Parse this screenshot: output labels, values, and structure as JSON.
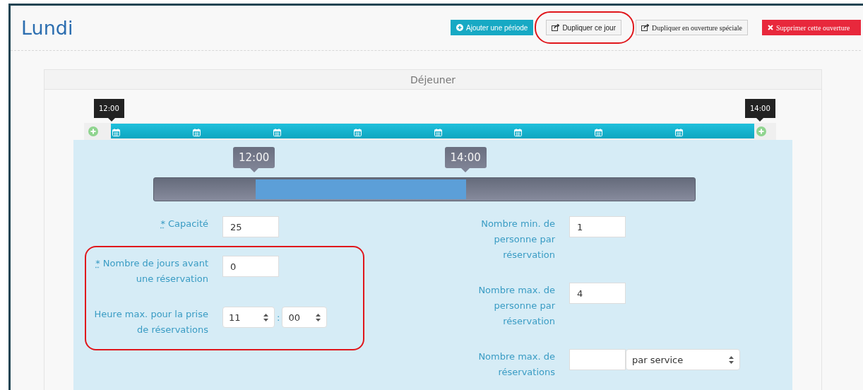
{
  "title": "Lundi",
  "buttons": [
    {
      "label": "Ajouter une période",
      "kind": "add",
      "circled": false
    },
    {
      "label": "Dupliquer ce jour",
      "kind": "duplicate",
      "circled": true
    },
    {
      "label": "Dupliquer en ouverture spéciale",
      "kind": "duplicate-special",
      "circled": false
    },
    {
      "label": "Supprimer cette ouverture",
      "kind": "delete",
      "circled": false
    }
  ],
  "period": {
    "title": "Déjeuner",
    "timeline": {
      "start": "12:00",
      "end": "14:00"
    },
    "slider": {
      "start": "12:00",
      "end": "14:00",
      "level": 0.39
    },
    "left_groups": [
      {
        "circled": false,
        "fields": [
          {
            "kind": "text",
            "mark": "*",
            "label": "Capacité",
            "value": "25"
          }
        ]
      },
      {
        "circled": true,
        "fields": [
          {
            "kind": "text",
            "mark": "*",
            "label": "Nombre de jours avant une réservation",
            "value": "0"
          },
          {
            "kind": "time",
            "label": "Heure max. pour la prise de réservations",
            "hour": "11",
            "separator": ":",
            "minute": "00"
          }
        ]
      }
    ],
    "right_fields": [
      {
        "kind": "text",
        "label": "Nombre min. de personne par réservation",
        "value": "1"
      },
      {
        "kind": "text",
        "label": "Nombre max. de personne par réservation",
        "value": "4"
      },
      {
        "kind": "text-select",
        "label": "Nombre max. de réservations",
        "option": "par service"
      }
    ]
  }
}
